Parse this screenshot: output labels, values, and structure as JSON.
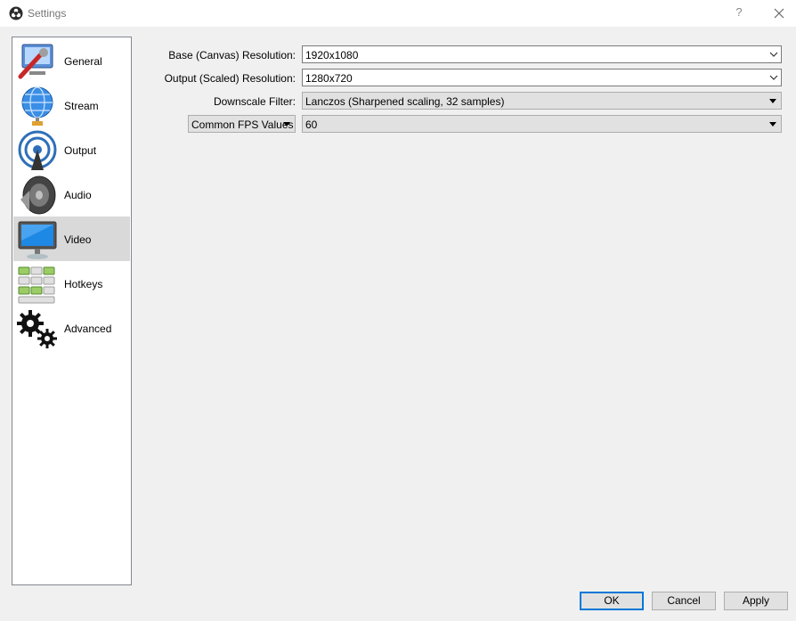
{
  "window": {
    "title": "Settings",
    "help": "?"
  },
  "sidebar": {
    "items": [
      {
        "label": "General",
        "icon": "general-icon",
        "selected": false
      },
      {
        "label": "Stream",
        "icon": "stream-icon",
        "selected": false
      },
      {
        "label": "Output",
        "icon": "output-icon",
        "selected": false
      },
      {
        "label": "Audio",
        "icon": "audio-icon",
        "selected": false
      },
      {
        "label": "Video",
        "icon": "video-icon",
        "selected": true
      },
      {
        "label": "Hotkeys",
        "icon": "hotkeys-icon",
        "selected": false
      },
      {
        "label": "Advanced",
        "icon": "advanced-icon",
        "selected": false
      }
    ]
  },
  "video": {
    "base_label": "Base (Canvas) Resolution:",
    "base_value": "1920x1080",
    "output_label": "Output (Scaled) Resolution:",
    "output_value": "1280x720",
    "filter_label": "Downscale Filter:",
    "filter_value": "Lanczos (Sharpened scaling, 32 samples)",
    "fps_type": "Common FPS Values",
    "fps_value": "60"
  },
  "buttons": {
    "ok": "OK",
    "cancel": "Cancel",
    "apply": "Apply"
  },
  "colors": {
    "selection": "#d9d9d9",
    "primary_border": "#0078d7"
  }
}
